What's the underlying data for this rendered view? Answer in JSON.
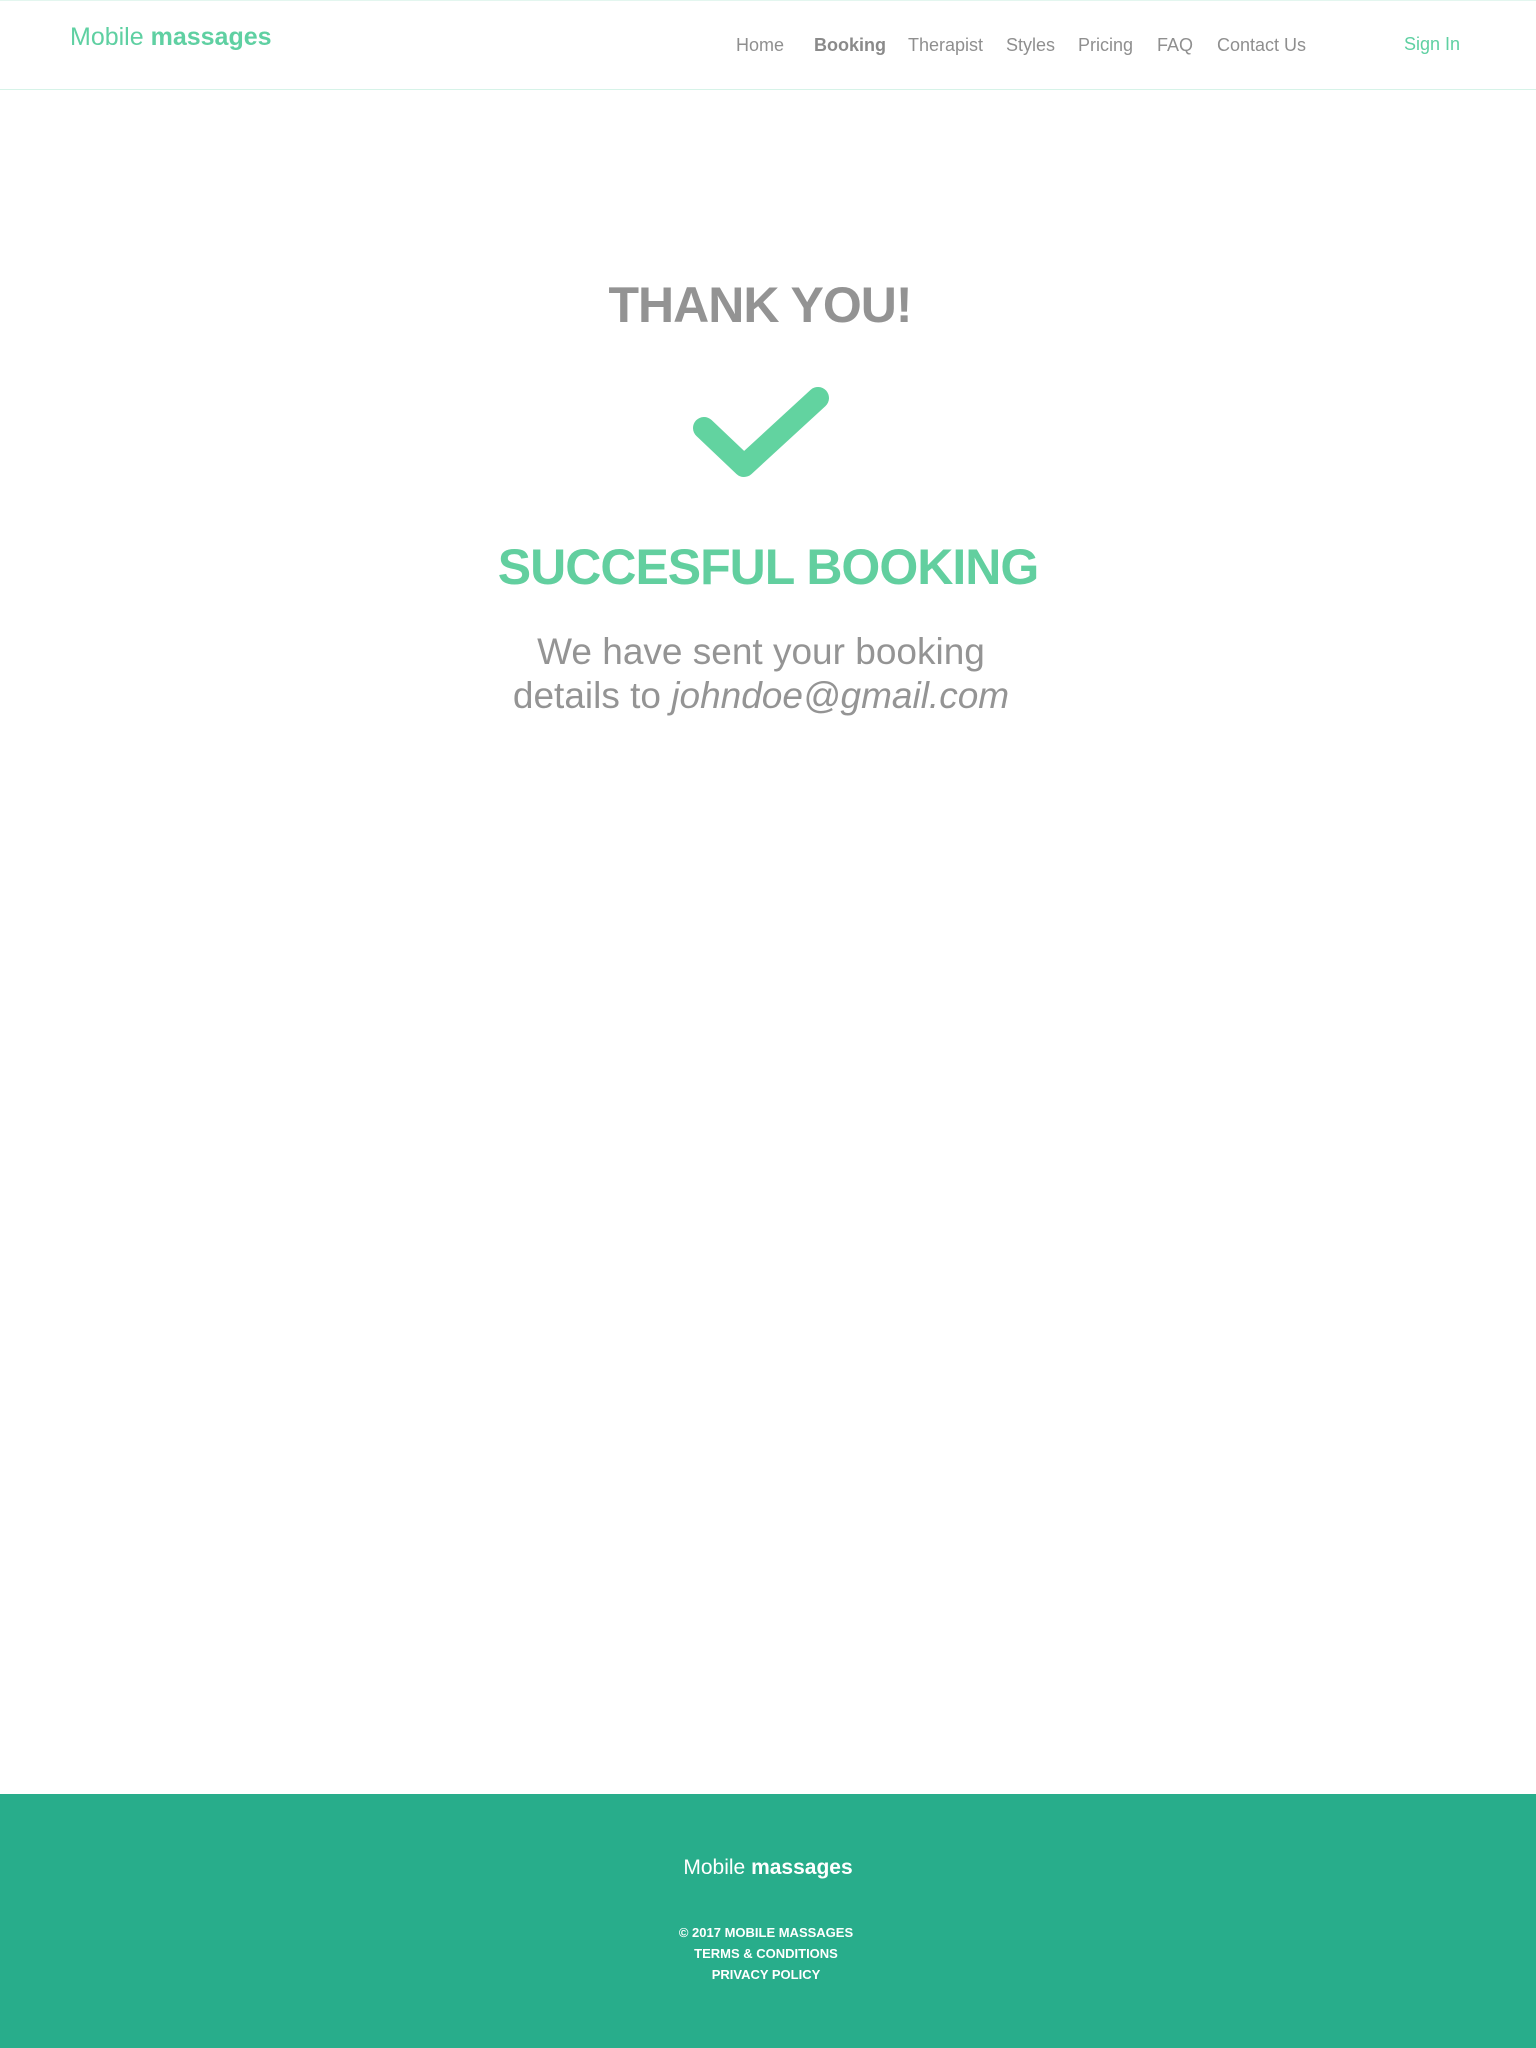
{
  "header": {
    "logo": {
      "light": "Mobile",
      "bold": "massages"
    },
    "nav": [
      {
        "label": "Home",
        "active": false
      },
      {
        "label": "Booking",
        "active": true
      },
      {
        "label": "Therapist",
        "active": false
      },
      {
        "label": "Styles",
        "active": false
      },
      {
        "label": "Pricing",
        "active": false
      },
      {
        "label": "FAQ",
        "active": false
      },
      {
        "label": "Contact Us",
        "active": false
      }
    ],
    "sign_in": "Sign In"
  },
  "main": {
    "thank_you": "THANK YOU!",
    "check_icon": "checkmark-icon",
    "success_title": "SUCCESFUL BOOKING",
    "message_line1": "We have sent your booking",
    "message_line2_prefix": "details to ",
    "email": "johndoe@gmail.com"
  },
  "footer": {
    "logo": {
      "light": "Mobile",
      "bold": "massages"
    },
    "copyright": "© 2017 MOBILE MASSAGES",
    "terms": "TERMS & CONDITIONS",
    "privacy": "PRIVACY POLICY"
  },
  "colors": {
    "accent": "#5fd0a2",
    "footer_bg": "#28ad8b",
    "text_gray": "#939393"
  }
}
